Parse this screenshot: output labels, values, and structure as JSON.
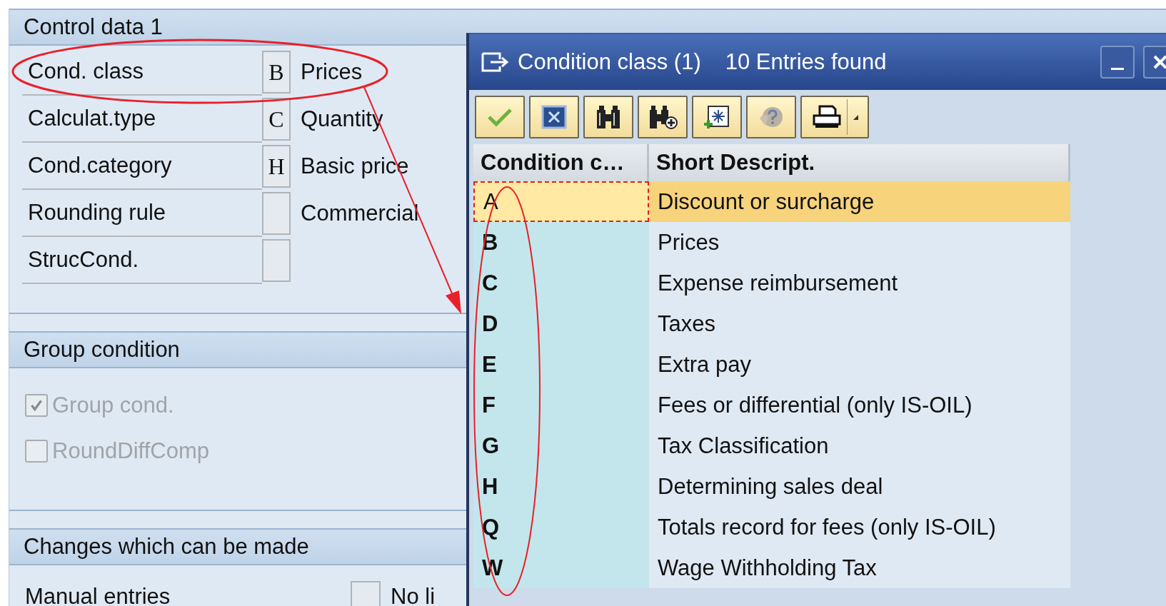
{
  "sections": [
    {
      "title": "Control data 1",
      "kind": "fields",
      "fields": [
        {
          "label": "Cond. class",
          "value": "B",
          "description": "Prices"
        },
        {
          "label": "Calculat.type",
          "value": "C",
          "description": "Quantity"
        },
        {
          "label": "Cond.category",
          "value": "H",
          "description": "Basic price"
        },
        {
          "label": "Rounding rule",
          "description": "Commercial"
        },
        {
          "label": "StrucCond."
        }
      ]
    },
    {
      "title": "Group condition",
      "kind": "checkboxes",
      "items": [
        {
          "label": "Group cond.",
          "checked": true,
          "disabled": true
        },
        {
          "label": "RoundDiffComp",
          "checked": false,
          "disabled": true
        }
      ]
    },
    {
      "title": "Changes which can be made",
      "kind": "options",
      "items": [
        {
          "label": "Manual entries",
          "checked": false,
          "option_label": "No li"
        }
      ]
    }
  ],
  "dialog": {
    "title": "Condition class (1)",
    "count": "10 Entries found",
    "columns": [
      "Condition c…",
      "Short Descript."
    ],
    "rows": [
      {
        "code": "A",
        "description": "Discount or surcharge",
        "selected": true
      },
      {
        "code": "B",
        "description": "Prices",
        "selected": false
      },
      {
        "code": "C",
        "description": "Expense reimbursement",
        "selected": false
      },
      {
        "code": "D",
        "description": "Taxes",
        "selected": false
      },
      {
        "code": "E",
        "description": "Extra pay",
        "selected": false
      },
      {
        "code": "F",
        "description": "Fees or differential (only IS-OIL)",
        "selected": false
      },
      {
        "code": "G",
        "description": "Tax Classification",
        "selected": false
      },
      {
        "code": "H",
        "description": "Determining sales deal",
        "selected": false
      },
      {
        "code": "Q",
        "description": "Totals record for fees (only IS-OIL)",
        "selected": false
      },
      {
        "code": "W",
        "description": "Wage Withholding Tax",
        "selected": false
      }
    ]
  }
}
